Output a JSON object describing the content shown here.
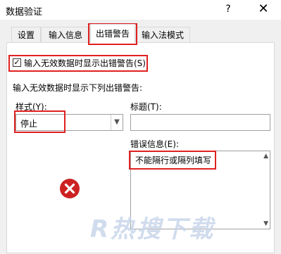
{
  "window": {
    "title": "数据验证",
    "help_glyph": "?",
    "close_glyph": "✕"
  },
  "tabs": [
    {
      "label": "设置"
    },
    {
      "label": "输入信息"
    },
    {
      "label": "出错警告"
    },
    {
      "label": "输入法模式"
    }
  ],
  "error_alert": {
    "show_alert_label": "输入无效数据时显示出错警告(S)",
    "show_alert_checked": true,
    "section_label": "输入无效数据时显示下列出错警告:",
    "style_label": "样式(Y):",
    "style_value": "停止",
    "title_label": "标题(T):",
    "title_value": "",
    "message_label": "错误信息(E):",
    "message_value": "不能隔行或隔列填写"
  },
  "watermark": "R热搜下载",
  "colors": {
    "highlight": "#e02020",
    "error_icon": "#cc2222"
  }
}
